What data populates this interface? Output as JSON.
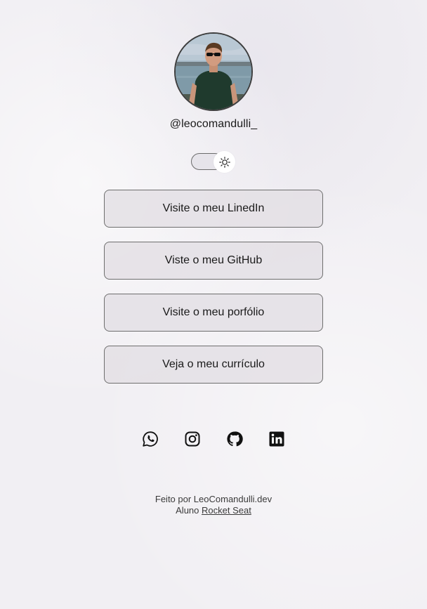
{
  "profile": {
    "handle": "@leocomandulli_",
    "avatar_alt": "profile-photo"
  },
  "theme_toggle": {
    "icon": "sun-icon",
    "state": "light"
  },
  "links": [
    {
      "label": "Visite o meu LinedIn"
    },
    {
      "label": "Viste o meu GitHub"
    },
    {
      "label": "Visite o meu porfólio"
    },
    {
      "label": "Veja o meu currículo"
    }
  ],
  "socials": [
    {
      "icon": "whatsapp-icon"
    },
    {
      "icon": "instagram-icon"
    },
    {
      "icon": "github-icon"
    },
    {
      "icon": "linkedin-icon"
    }
  ],
  "footer": {
    "made_by": "Feito por LeoComandulli.dev",
    "student_prefix": "Aluno",
    "student_link": "Rocket Seat"
  },
  "colors": {
    "background": "#f1eff3",
    "button_bg": "#e1dee3",
    "border": "#6e6e6e",
    "text": "#1a1a1a"
  }
}
